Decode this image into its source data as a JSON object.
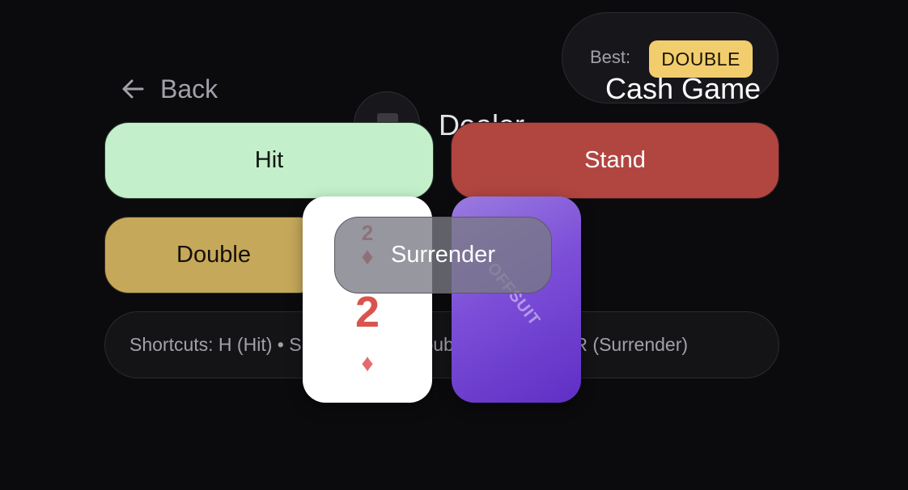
{
  "nav": {
    "back_label": "Back"
  },
  "header": {
    "best_label": "Best:",
    "best_value": "DOUBLE",
    "mode_title": "Cash Game",
    "dealer_label": "Dealer"
  },
  "actions": {
    "hit": "Hit",
    "stand": "Stand",
    "double": "Double",
    "surrender": "Surrender"
  },
  "cards": {
    "player_card": {
      "rank": "2",
      "suit": "♦"
    },
    "hidden_card_tag": "OFFSUIT"
  },
  "shortcuts": {
    "text": "Shortcuts: H (Hit) • S (Stand) • D (Double) • P (Split) • R (Surrender)"
  },
  "colors": {
    "background": "#0b0b0e",
    "hit": "#c3f0ca",
    "stand": "#b14540",
    "double": "#c6a85a",
    "best_badge": "#f2cd6d",
    "card_back": "#7c4ed8",
    "suit_red": "#d9534f"
  },
  "icons": {
    "back": "arrow-left-icon",
    "dealer": "dealer-avatar-icon",
    "suit": "diamond-icon"
  }
}
